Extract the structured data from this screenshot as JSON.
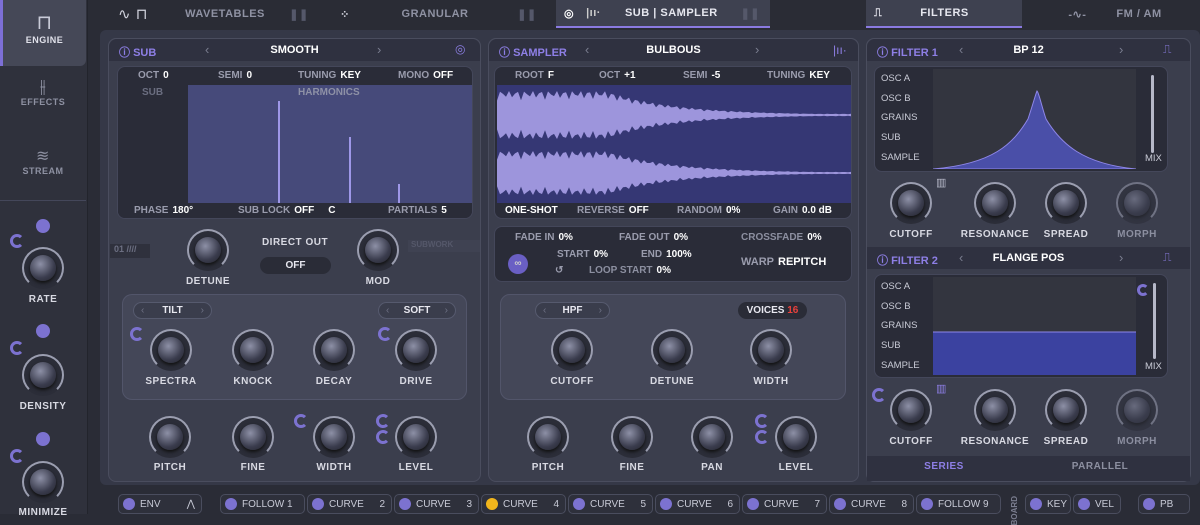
{
  "sidebar": {
    "items": [
      {
        "label": "ENGINE",
        "icon": "square-wave-icon"
      },
      {
        "label": "EFFECTS",
        "icon": "sliders-icon"
      },
      {
        "label": "STREAM",
        "icon": "stream-icon"
      }
    ],
    "macros": [
      {
        "label": "RATE"
      },
      {
        "label": "DENSITY"
      },
      {
        "label": "MINIMIZE"
      }
    ]
  },
  "tabs": [
    {
      "label": "WAVETABLES"
    },
    {
      "label": "GRANULAR"
    },
    {
      "label": "SUB | SAMPLER",
      "active": true
    },
    {
      "label": "FILTERS",
      "active": true
    },
    {
      "label": "FM / AM"
    }
  ],
  "sub": {
    "title": "SUB",
    "preset": "SMOOTH",
    "oct": "0",
    "semi": "0",
    "tuning": "KEY",
    "mono": "OFF",
    "oct_label": "OCT",
    "semi_label": "SEMI",
    "tuning_label": "TUNING",
    "mono_label": "MONO",
    "sub_label": "SUB",
    "harmonics_label": "HARMONICS",
    "phase_label": "PHASE",
    "phase": "180°",
    "sublock_label": "SUB LOCK",
    "sublock": "OFF",
    "sublock_note": "C",
    "partials_label": "PARTIALS",
    "partials": "5",
    "badge": "01",
    "subwork": "SUBWORK",
    "detune": "DETUNE",
    "direct_out": "DIRECT OUT",
    "direct_out_value": "OFF",
    "mod": "MOD",
    "tilt": "TILT",
    "soft": "SOFT",
    "knobs": [
      "SPECTRA",
      "KNOCK",
      "DECAY",
      "DRIVE"
    ],
    "knobs2": [
      "PITCH",
      "FINE",
      "WIDTH",
      "LEVEL"
    ]
  },
  "sampler": {
    "title": "SAMPLER",
    "preset": "BULBOUS",
    "root_label": "ROOT",
    "root": "F",
    "oct_label": "OCT",
    "oct": "+1",
    "semi_label": "SEMI",
    "semi": "-5",
    "tuning_label": "TUNING",
    "tuning": "KEY",
    "oneshot": "ONE-SHOT",
    "reverse_label": "REVERSE",
    "reverse": "OFF",
    "random_label": "RANDOM",
    "random": "0%",
    "gain_label": "GAIN",
    "gain": "0.0 dB",
    "fadein_label": "FADE IN",
    "fadein": "0%",
    "fadeout_label": "FADE OUT",
    "fadeout": "0%",
    "crossfade_label": "CROSSFADE",
    "crossfade": "0%",
    "start_label": "START",
    "start": "0%",
    "end_label": "END",
    "end": "100%",
    "loopstart_label": "LOOP START",
    "loopstart": "0%",
    "warp_label": "WARP",
    "warp": "REPITCH",
    "filter": "HPF",
    "voices_label": "VOICES",
    "voices": "16",
    "knobs": [
      "CUTOFF",
      "DETUNE",
      "WIDTH"
    ],
    "knobs2": [
      "PITCH",
      "FINE",
      "PAN",
      "LEVEL"
    ]
  },
  "filters": {
    "sources": [
      "OSC A",
      "OSC B",
      "GRAINS",
      "SUB",
      "SAMPLE"
    ],
    "mix": "MIX",
    "f1": {
      "title": "FILTER 1",
      "preset": "BP 12"
    },
    "f2": {
      "title": "FILTER 2",
      "preset": "FLANGE POS"
    },
    "knobs": [
      "CUTOFF",
      "RESONANCE",
      "SPREAD",
      "MORPH"
    ],
    "series": "SERIES",
    "parallel": "PARALLEL"
  },
  "modbar": {
    "items": [
      {
        "label": "ENV"
      },
      {
        "label": "FOLLOW 1"
      },
      {
        "label": "CURVE",
        "num": "2"
      },
      {
        "label": "CURVE",
        "num": "3"
      },
      {
        "label": "CURVE",
        "num": "4",
        "active": true
      },
      {
        "label": "CURVE",
        "num": "5"
      },
      {
        "label": "CURVE",
        "num": "6"
      },
      {
        "label": "CURVE",
        "num": "7"
      },
      {
        "label": "CURVE",
        "num": "8"
      },
      {
        "label": "FOLLOW 9"
      }
    ],
    "board": "BOARD",
    "key": "KEY",
    "vel": "VEL",
    "pb": "PB"
  },
  "colors": {
    "accent": "#8e7fe6",
    "active_mod": "#f1b51c",
    "voices": "#e8413c"
  }
}
